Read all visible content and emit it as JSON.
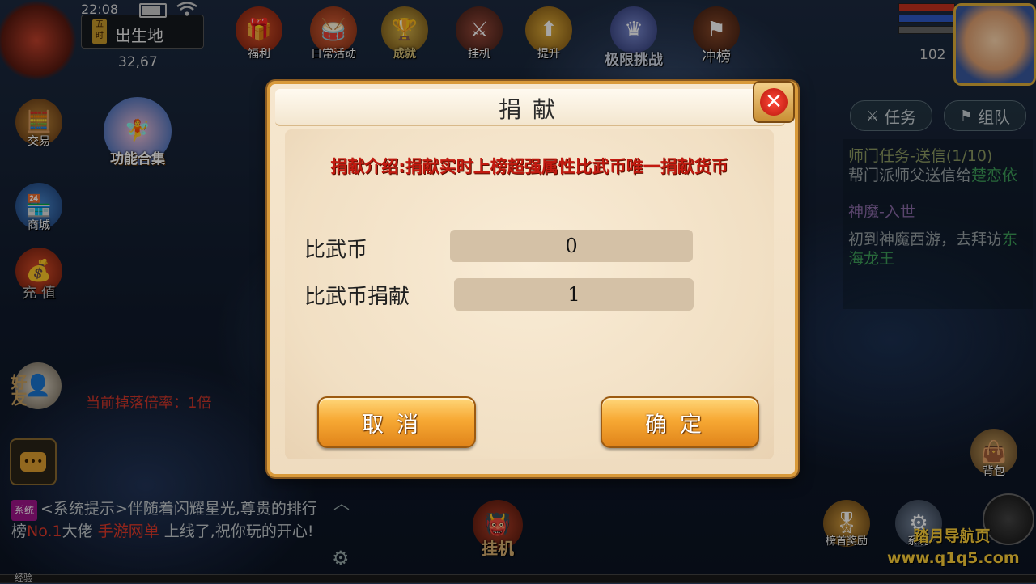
{
  "status_bar": {
    "time": "22:08"
  },
  "location": {
    "badge": "五时",
    "map_name": "出生地",
    "coords": "32,67"
  },
  "top_menu": [
    {
      "label": "福利",
      "icon": "gift-bag-icon"
    },
    {
      "label": "日常活动",
      "icon": "drum-icon"
    },
    {
      "label": "成就",
      "icon": "trophy-icon"
    },
    {
      "label": "挂机",
      "icon": "sword-icon"
    },
    {
      "label": "提升",
      "icon": "arrow-up-icon"
    },
    {
      "label": "极限挑战",
      "icon": "crown-icon"
    },
    {
      "label": "冲榜",
      "icon": "banner-icon"
    }
  ],
  "player": {
    "level": "102"
  },
  "left_menu": {
    "trade": "交易",
    "feature_collection": "功能合集",
    "shop": "商城",
    "recharge": "充 值",
    "friends": "好友"
  },
  "right_panel": {
    "tabs": [
      "任务",
      "组队"
    ],
    "quests": [
      {
        "title": "师门任务-送信(1/10)",
        "desc": "帮门派师父送信给",
        "target": "楚恋依"
      },
      {
        "title": "神魔-入世",
        "desc": "初到神魔西游，去拜访",
        "target": "东海龙王"
      }
    ],
    "bag": "背包"
  },
  "modal": {
    "title": "捐献",
    "intro": "捐献介绍:捐献实时上榜超强属性比武币唯一捐献货币",
    "fields": [
      {
        "label": "比武币",
        "value": "0"
      },
      {
        "label": "比武币捐献",
        "value": "1"
      }
    ],
    "cancel_label": "取消",
    "confirm_label": "确定"
  },
  "drop_rate": "当前掉落倍率：1倍",
  "chat": {
    "tag": "系统",
    "pre": "<系统提示>伴随着闪耀星光,尊贵的排行榜",
    "rank": "No.1",
    "mid": "大佬",
    "name": "手游网单",
    "post": "上线了,祝你玩的开心!"
  },
  "bottom": {
    "afk": "挂机",
    "top_reward": "榜首奖励",
    "system": "系统",
    "exp": "经验"
  },
  "watermark": {
    "line1": "踏月导航页",
    "line2": "www.q1q5.com"
  },
  "colors": {
    "modal_border": "#d99a3a",
    "intro_red": "#c21a10",
    "button_gold": "#f7a934"
  }
}
